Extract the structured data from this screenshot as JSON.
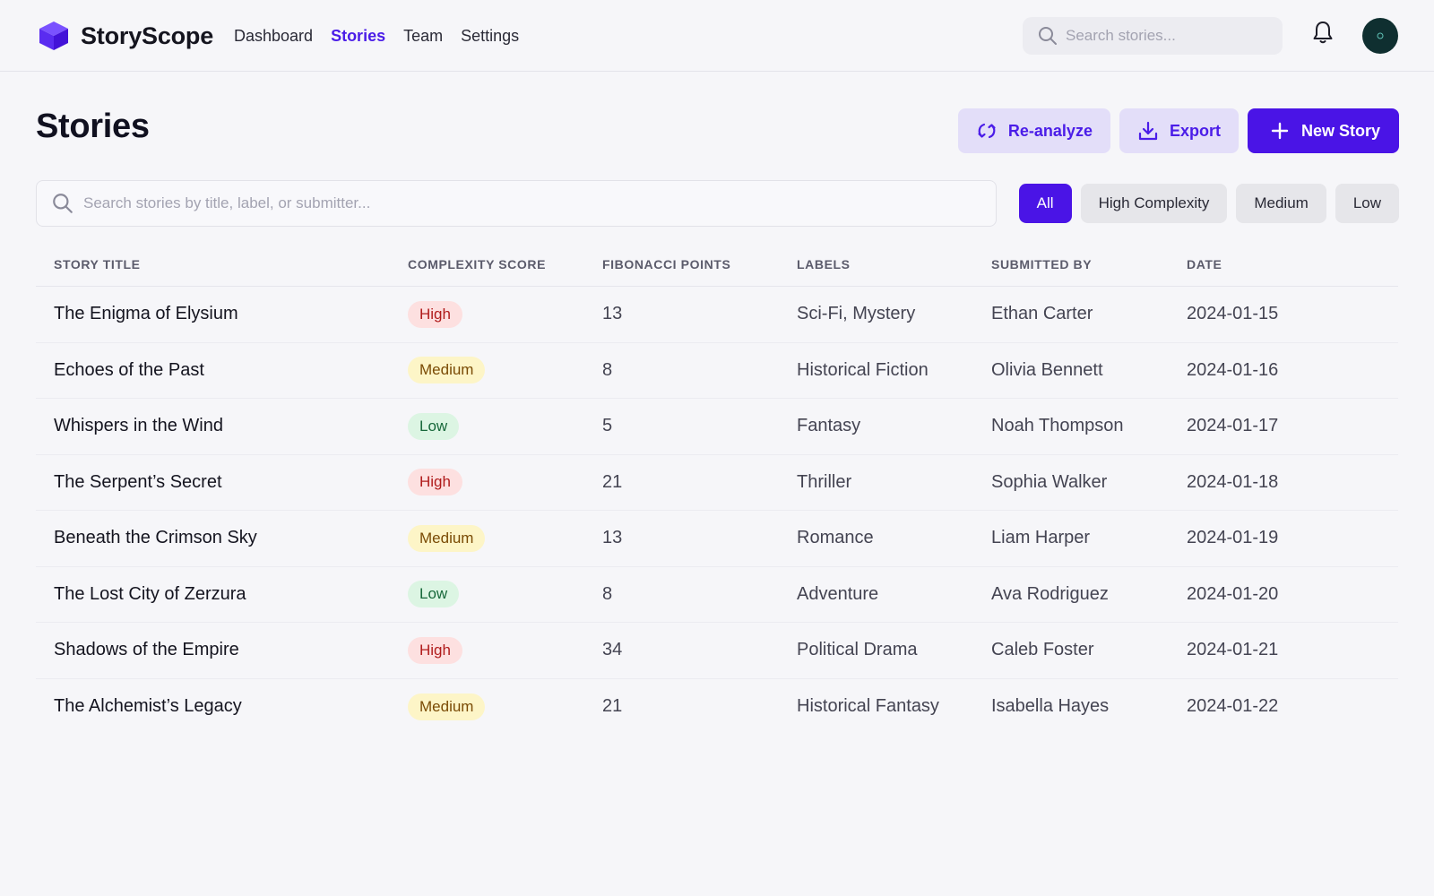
{
  "header": {
    "brand": "StoryScope",
    "nav": [
      {
        "label": "Dashboard",
        "active": false
      },
      {
        "label": "Stories",
        "active": true
      },
      {
        "label": "Team",
        "active": false
      },
      {
        "label": "Settings",
        "active": false
      }
    ],
    "search_placeholder": "Search stories...",
    "icons": {
      "search": "search-icon",
      "notifications": "bell-icon",
      "avatar": "user-avatar"
    }
  },
  "page": {
    "title": "Stories",
    "actions": {
      "reanalyze": "Re-analyze",
      "export": "Export",
      "new_story": "New Story"
    }
  },
  "filters": {
    "search_placeholder": "Search stories by title, label, or submitter...",
    "options": [
      "All",
      "High Complexity",
      "Medium",
      "Low"
    ],
    "active": "All"
  },
  "table": {
    "columns": [
      "Story Title",
      "Complexity Score",
      "Fibonacci Points",
      "Labels",
      "Submitted By",
      "Date"
    ],
    "rows": [
      {
        "title": "The Enigma of Elysium",
        "complexity": "High",
        "points": "13",
        "labels": "Sci-Fi, Mystery",
        "submitter": "Ethan Carter",
        "date": "2024-01-15"
      },
      {
        "title": "Echoes of the Past",
        "complexity": "Medium",
        "points": "8",
        "labels": "Historical Fiction",
        "submitter": "Olivia Bennett",
        "date": "2024-01-16"
      },
      {
        "title": "Whispers in the Wind",
        "complexity": "Low",
        "points": "5",
        "labels": "Fantasy",
        "submitter": "Noah Thompson",
        "date": "2024-01-17"
      },
      {
        "title": "The Serpent’s Secret",
        "complexity": "High",
        "points": "21",
        "labels": "Thriller",
        "submitter": "Sophia Walker",
        "date": "2024-01-18"
      },
      {
        "title": "Beneath the Crimson Sky",
        "complexity": "Medium",
        "points": "13",
        "labels": "Romance",
        "submitter": "Liam Harper",
        "date": "2024-01-19"
      },
      {
        "title": "The Lost City of Zerzura",
        "complexity": "Low",
        "points": "8",
        "labels": "Adventure",
        "submitter": "Ava Rodriguez",
        "date": "2024-01-20"
      },
      {
        "title": "Shadows of the Empire",
        "complexity": "High",
        "points": "34",
        "labels": "Political Drama",
        "submitter": "Caleb Foster",
        "date": "2024-01-21"
      },
      {
        "title": "The Alchemist’s Legacy",
        "complexity": "Medium",
        "points": "21",
        "labels": "Historical Fantasy",
        "submitter": "Isabella Hayes",
        "date": "2024-01-22"
      }
    ]
  },
  "colors": {
    "accent": "#4a14e6",
    "accent_soft": "#e3def9",
    "high_bg": "#fde0e0",
    "medium_bg": "#fdf5c7",
    "low_bg": "#dcf5e3"
  }
}
